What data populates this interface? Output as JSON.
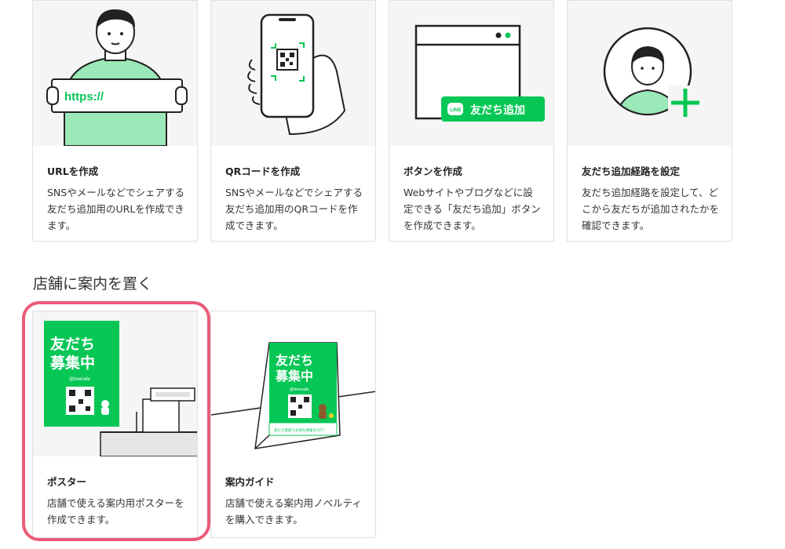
{
  "cards_top": [
    {
      "title": "URLを作成",
      "desc": "SNSやメールなどでシェアする友だち追加用のURLを作成できます。",
      "illustration_text": "https://"
    },
    {
      "title": "QRコードを作成",
      "desc": "SNSやメールなどでシェアする友だち追加用のQRコードを作成できます。"
    },
    {
      "title": "ボタンを作成",
      "desc": "Webサイトやブログなどに設定できる「友だち追加」ボタンを作成できます。",
      "illustration_text": "友だち追加",
      "badge_text": "LINE"
    },
    {
      "title": "友だち追加経路を設定",
      "desc": "友だち追加経路を設定して、どこから友だちが追加されたかを確認できます。"
    }
  ],
  "section": {
    "title": "店舗に案内を置く"
  },
  "cards_bottom": [
    {
      "title": "ポスター",
      "desc": "店舗で使える案内用ポスターを作成できます。",
      "poster_text_1": "友だち",
      "poster_text_2": "募集中",
      "poster_handle": "@linecafe"
    },
    {
      "title": "案内ガイド",
      "desc": "店舗で使える案内用ノベルティを購入できます。",
      "poster_text_1": "友だち",
      "poster_text_2": "募集中",
      "poster_handle": "@linecafe",
      "strip_text": "友だち登録でお得な情報をGET!"
    }
  ],
  "colors": {
    "line_green": "#06c755",
    "light_green": "#9be9b8",
    "highlight": "#eb5a78"
  }
}
